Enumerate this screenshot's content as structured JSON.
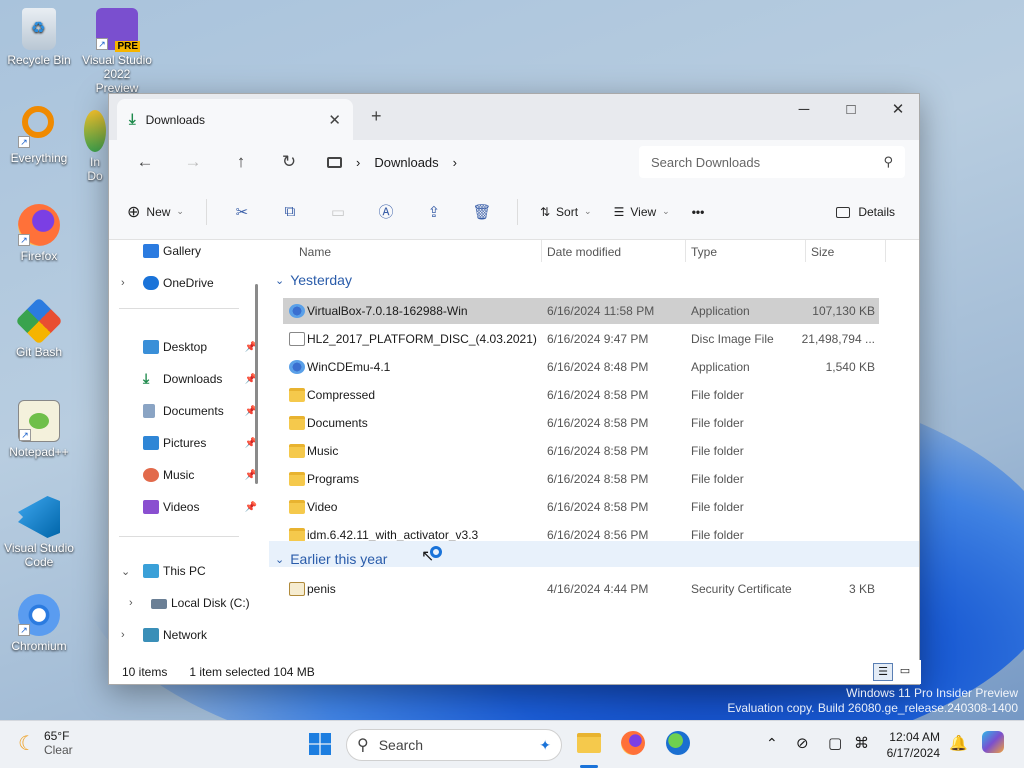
{
  "desktop": {
    "icons": [
      {
        "label": "Recycle Bin",
        "icon": "recycle-bin-icon"
      },
      {
        "label": "Visual Studio 2022 Preview",
        "icon": "visual-studio-preview-icon",
        "badge": "PRE"
      },
      {
        "label": "Everything",
        "icon": "everything-search-icon"
      },
      {
        "label": "In Do",
        "icon": "app-icon"
      },
      {
        "label": "Firefox",
        "icon": "firefox-icon"
      },
      {
        "label": "Git Bash",
        "icon": "git-bash-icon"
      },
      {
        "label": "Notepad++",
        "icon": "notepadpp-icon"
      },
      {
        "label": "Visual Studio Code",
        "icon": "vscode-icon"
      },
      {
        "label": "Chromium",
        "icon": "chromium-icon"
      }
    ]
  },
  "window": {
    "tab_title": "Downloads",
    "new_tab": "+",
    "controls": {
      "minimize": "─",
      "maximize": "□",
      "close": "✕"
    },
    "nav": {
      "back": "←",
      "forward": "→",
      "up": "↑",
      "refresh": "↻"
    },
    "breadcrumb": {
      "item": "Downloads",
      "sep": "›"
    },
    "search_placeholder": "Search Downloads",
    "toolbar": {
      "new": "New",
      "sort": "Sort",
      "view": "View",
      "more": "•••",
      "details": "Details"
    },
    "sidebar": {
      "gallery": "Gallery",
      "onedrive": "OneDrive",
      "quick": [
        "Desktop",
        "Downloads",
        "Documents",
        "Pictures",
        "Music",
        "Videos"
      ],
      "this_pc": "This PC",
      "local_disk": "Local Disk (C:)",
      "network": "Network"
    },
    "columns": {
      "name": "Name",
      "date": "Date modified",
      "type": "Type",
      "size": "Size"
    },
    "groups": {
      "yesterday": "Yesterday",
      "earlier": "Earlier this year"
    },
    "files": [
      {
        "name": "VirtualBox-7.0.18-162988-Win",
        "date": "6/16/2024 11:58 PM",
        "type": "Application",
        "size": "107,130 KB",
        "kind": "app",
        "selected": true
      },
      {
        "name": "HL2_2017_PLATFORM_DISC_(4.03.2021)",
        "date": "6/16/2024 9:47 PM",
        "type": "Disc Image File",
        "size": "21,498,794 ...",
        "kind": "file"
      },
      {
        "name": "WinCDEmu-4.1",
        "date": "6/16/2024 8:48 PM",
        "type": "Application",
        "size": "1,540 KB",
        "kind": "app"
      },
      {
        "name": "Compressed",
        "date": "6/16/2024 8:58 PM",
        "type": "File folder",
        "size": "",
        "kind": "folder"
      },
      {
        "name": "Documents",
        "date": "6/16/2024 8:58 PM",
        "type": "File folder",
        "size": "",
        "kind": "folder"
      },
      {
        "name": "Music",
        "date": "6/16/2024 8:58 PM",
        "type": "File folder",
        "size": "",
        "kind": "folder"
      },
      {
        "name": "Programs",
        "date": "6/16/2024 8:58 PM",
        "type": "File folder",
        "size": "",
        "kind": "folder"
      },
      {
        "name": "Video",
        "date": "6/16/2024 8:58 PM",
        "type": "File folder",
        "size": "",
        "kind": "folder"
      },
      {
        "name": "idm.6.42.11_with_activator_v3.3",
        "date": "6/16/2024 8:56 PM",
        "type": "File folder",
        "size": "",
        "kind": "folder"
      }
    ],
    "earlier_files": [
      {
        "name": "penis",
        "date": "4/16/2024 4:44 PM",
        "type": "Security Certificate",
        "size": "3 KB",
        "kind": "cert"
      }
    ],
    "status": {
      "count": "10 items",
      "selection": "1 item selected  104 MB"
    }
  },
  "watermark": {
    "line1": "Windows 11 Pro Insider Preview",
    "line2": "Evaluation copy. Build 26080.ge_release.240308-1400"
  },
  "taskbar": {
    "weather_temp": "65°F",
    "weather_desc": "Clear",
    "search": "Search",
    "time": "12:04 AM",
    "date": "6/17/2024"
  },
  "colors": {
    "accent": "#2a5caa",
    "selection": "#cfcfcf",
    "folder": "#f5c94c"
  }
}
